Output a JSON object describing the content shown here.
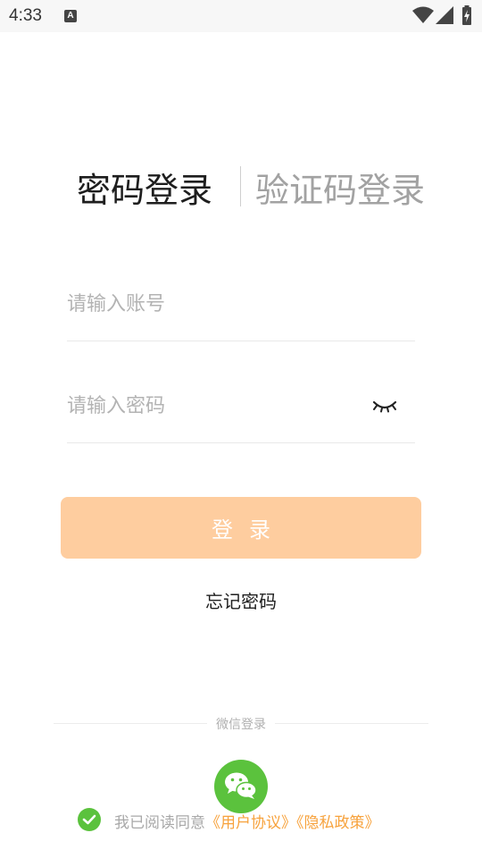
{
  "status_bar": {
    "time": "4:33",
    "icons": [
      "a-notification-icon",
      "wifi-icon",
      "cell-signal-icon",
      "battery-charging-icon"
    ]
  },
  "tabs": {
    "password_login": "密码登录",
    "code_login": "验证码登录"
  },
  "form": {
    "account_placeholder": "请输入账号",
    "password_placeholder": "请输入密码",
    "account_value": "",
    "password_value": "",
    "password_toggle_icon": "eye-closed-icon"
  },
  "login_button": "登录",
  "forgot_password": "忘记密码",
  "third_party": {
    "divider_label": "微信登录",
    "wechat_icon": "wechat-icon"
  },
  "agreement": {
    "checked": true,
    "prefix": "我已阅读同意",
    "user_agreement": "《用户协议》",
    "privacy_policy": "《隐私政策》"
  },
  "colors": {
    "login_button_bg": "#fecd9f",
    "link": "#f7a23c",
    "wechat_green": "#5bc23d",
    "active_tab": "#1e1e1e",
    "inactive_tab": "#a2a2a2"
  }
}
